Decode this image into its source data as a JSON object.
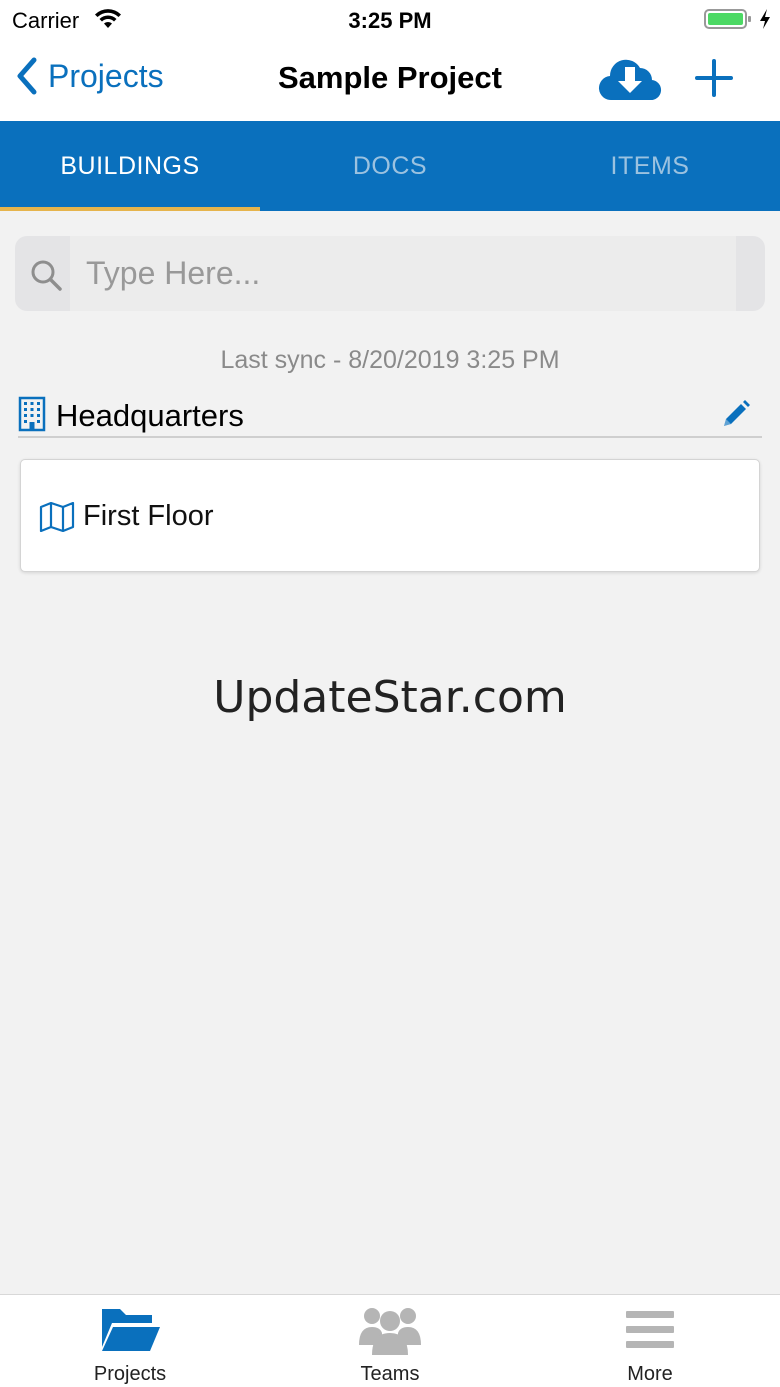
{
  "status_bar": {
    "carrier": "Carrier",
    "time": "3:25 PM",
    "battery_color": "#4cd964"
  },
  "nav": {
    "back_label": "Projects",
    "title": "Sample Project",
    "accent_color": "#0a70bd",
    "cloud_icon": "cloud-download-icon",
    "add_icon": "plus-icon"
  },
  "tabs": [
    {
      "label": "BUILDINGS",
      "active": true
    },
    {
      "label": "DOCS",
      "active": false
    },
    {
      "label": "ITEMS",
      "active": false
    }
  ],
  "tab_indicator_color": "#e6b44c",
  "search": {
    "placeholder": "Type Here...",
    "value": ""
  },
  "last_sync": "Last sync - 8/20/2019 3:25 PM",
  "buildings": [
    {
      "name": "Headquarters",
      "icon": "building-icon",
      "floors": [
        {
          "name": "First Floor",
          "icon": "map-icon"
        }
      ]
    }
  ],
  "watermark": "UpdateStar.com",
  "tab_bar": [
    {
      "label": "Projects",
      "icon": "folder-open-icon",
      "active": true
    },
    {
      "label": "Teams",
      "icon": "users-icon",
      "active": false
    },
    {
      "label": "More",
      "icon": "menu-icon",
      "active": false
    }
  ]
}
